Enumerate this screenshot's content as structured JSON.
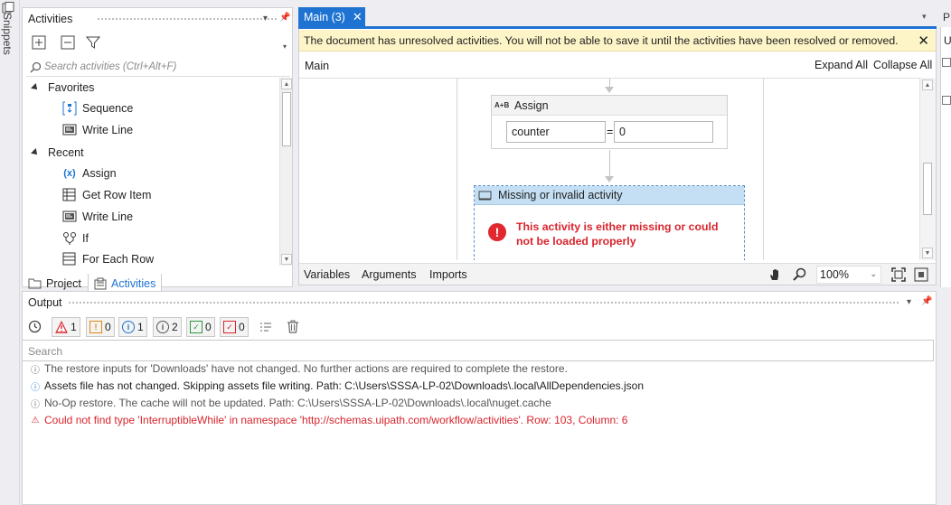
{
  "snippets": {
    "label": "Snippets"
  },
  "activities_panel": {
    "title": "Activities",
    "search_placeholder": "Search activities (Ctrl+Alt+F)",
    "tree": [
      {
        "kind": "group",
        "label": "Favorites",
        "icon": "expand-triangle-icon"
      },
      {
        "kind": "item",
        "label": "Sequence",
        "icon": "sequence-icon"
      },
      {
        "kind": "item",
        "label": "Write Line",
        "icon": "write-line-icon"
      },
      {
        "kind": "group",
        "label": "Recent",
        "icon": "expand-triangle-icon"
      },
      {
        "kind": "item",
        "label": "Assign",
        "icon": "assign-icon"
      },
      {
        "kind": "item",
        "label": "Get Row Item",
        "icon": "get-row-item-icon"
      },
      {
        "kind": "item",
        "label": "Write Line",
        "icon": "write-line-icon"
      },
      {
        "kind": "item",
        "label": "If",
        "icon": "if-icon"
      },
      {
        "kind": "item",
        "label": "For Each Row",
        "icon": "for-each-row-icon"
      }
    ],
    "bottom_tabs": {
      "project": "Project",
      "activities": "Activities"
    }
  },
  "designer": {
    "tab_label": "Main (3)",
    "warning": "The document has unresolved activities. You will not be able to save it until the activities have been resolved or removed.",
    "breadcrumb": "Main",
    "expand_all": "Expand All",
    "collapse_all": "Collapse All",
    "assign": {
      "title": "Assign",
      "icon_text": "A+B",
      "left": "counter",
      "equals": "=",
      "right": "0"
    },
    "missing": {
      "title": "Missing or invalid activity",
      "message": "This activity is either missing or could not be loaded properly"
    },
    "footer": {
      "variables": "Variables",
      "arguments": "Arguments",
      "imports": "Imports",
      "zoom": "100%"
    }
  },
  "properties": {
    "tab_letter": "P",
    "letter2": "U"
  },
  "output_panel": {
    "title": "Output",
    "filters": [
      {
        "name": "errors",
        "count": "1",
        "color": "#d9242c",
        "symbol": "!"
      },
      {
        "name": "warnings",
        "count": "0",
        "color": "#e08a12",
        "symbol": "!"
      },
      {
        "name": "info",
        "count": "1",
        "color": "#1e73d2",
        "symbol": "i"
      },
      {
        "name": "trace",
        "count": "2",
        "color": "#555555",
        "symbol": "i"
      },
      {
        "name": "success",
        "count": "0",
        "color": "#2c9a3a",
        "symbol": "✓"
      },
      {
        "name": "failed",
        "count": "0",
        "color": "#d9242c",
        "symbol": "✓"
      }
    ],
    "search_placeholder": "Search",
    "logs": [
      {
        "level": "trace",
        "text": "The restore inputs for 'Downloads' have not changed. No further actions are required to complete the restore."
      },
      {
        "level": "info",
        "text": "Assets file has not changed. Skipping assets file writing. Path: C:\\Users\\SSSA-LP-02\\Downloads\\.local\\AllDependencies.json"
      },
      {
        "level": "trace",
        "text": "No-Op restore. The cache will not be updated. Path: C:\\Users\\SSSA-LP-02\\Downloads\\.local\\nuget.cache"
      },
      {
        "level": "error",
        "text": "Could not find type 'InterruptibleWhile' in namespace 'http://schemas.uipath.com/workflow/activities'. Row: 103, Column: 6"
      }
    ]
  }
}
